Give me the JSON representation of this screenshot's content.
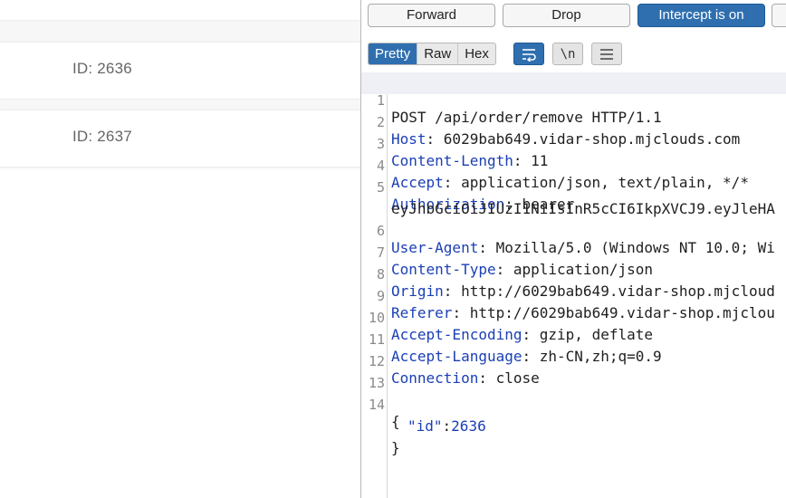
{
  "left_page": {
    "orders": [
      {
        "label": "ID:",
        "value": "2636"
      },
      {
        "label": "ID:",
        "value": "2637"
      }
    ]
  },
  "toolbar": {
    "forward_label": "Forward",
    "drop_label": "Drop",
    "intercept_label": "Intercept is on"
  },
  "view_modes": {
    "pretty": "Pretty",
    "raw": "Raw",
    "hex": "Hex",
    "newline_label": "\\n"
  },
  "request": {
    "request_line": "POST /api/order/remove HTTP/1.1",
    "headers": [
      {
        "name": "Host",
        "value": "6029bab649.vidar-shop.mjclouds.com"
      },
      {
        "name": "Content-Length",
        "value": "11"
      },
      {
        "name": "Accept",
        "value": "application/json, text/plain, */*"
      },
      {
        "name": "Authorization",
        "value": "bearer"
      },
      {
        "name": "User-Agent",
        "value": "Mozilla/5.0 (Windows NT 10.0; Wi"
      },
      {
        "name": "Content-Type",
        "value": "application/json"
      },
      {
        "name": "Origin",
        "value": "http://6029bab649.vidar-shop.mjcloud"
      },
      {
        "name": "Referer",
        "value": "http://6029bab649.vidar-shop.mjclou"
      },
      {
        "name": "Accept-Encoding",
        "value": "gzip, deflate"
      },
      {
        "name": "Accept-Language",
        "value": "zh-CN,zh;q=0.9"
      },
      {
        "name": "Connection",
        "value": "close"
      }
    ],
    "auth_token_fragment": "eyJhbGciOiJIUzI1NiIsInR5cCI6IkpXVCJ9.eyJleHA",
    "body": {
      "open_brace": "{",
      "key": "\"id\"",
      "colon": ":",
      "value": "2636",
      "close_brace": "}"
    }
  },
  "line_numbers": [
    "1",
    "2",
    "3",
    "4",
    "5",
    "6",
    "7",
    "8",
    "9",
    "10",
    "11",
    "12",
    "13",
    "14"
  ],
  "colors": {
    "accent": "#2f6fb0",
    "header_name": "#1b3fb5"
  },
  "icons": {
    "wrap": "text-wrap-icon",
    "menu": "hamburger-menu-icon"
  }
}
